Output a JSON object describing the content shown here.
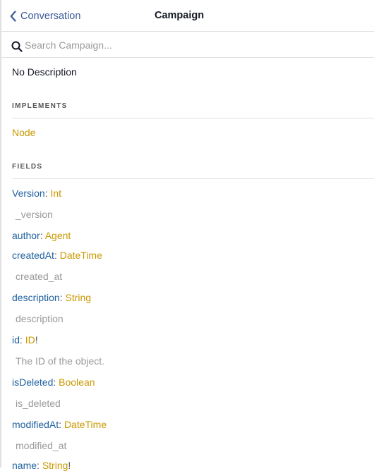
{
  "header": {
    "back_label": "Conversation",
    "title": "Campaign"
  },
  "search": {
    "placeholder": "Search Campaign..."
  },
  "type_description": "No Description",
  "implements": {
    "heading": "IMPLEMENTS",
    "items": [
      "Node"
    ]
  },
  "fields_section": {
    "heading": "FIELDS",
    "fields": [
      {
        "name": "Version",
        "type": "Int",
        "suffix": "",
        "description": "_version"
      },
      {
        "name": "author",
        "type": "Agent",
        "suffix": "",
        "description": ""
      },
      {
        "name": "createdAt",
        "type": "DateTime",
        "suffix": "",
        "description": "created_at"
      },
      {
        "name": "description",
        "type": "String",
        "suffix": "",
        "description": "description"
      },
      {
        "name": "id",
        "type": "ID",
        "suffix": "!",
        "description": "The ID of the object."
      },
      {
        "name": "isDeleted",
        "type": "Boolean",
        "suffix": "",
        "description": "is_deleted"
      },
      {
        "name": "modifiedAt",
        "type": "DateTime",
        "suffix": "",
        "description": "modified_at"
      },
      {
        "name": "name",
        "type": "String",
        "suffix": "!",
        "description": ""
      }
    ]
  },
  "colors": {
    "link_blue": "#3b5998",
    "field_blue": "#1f61a0",
    "type_gold": "#ca9800",
    "muted_gray": "#999999"
  },
  "icons": {
    "back": "chevron-left-icon",
    "search": "search-icon"
  }
}
